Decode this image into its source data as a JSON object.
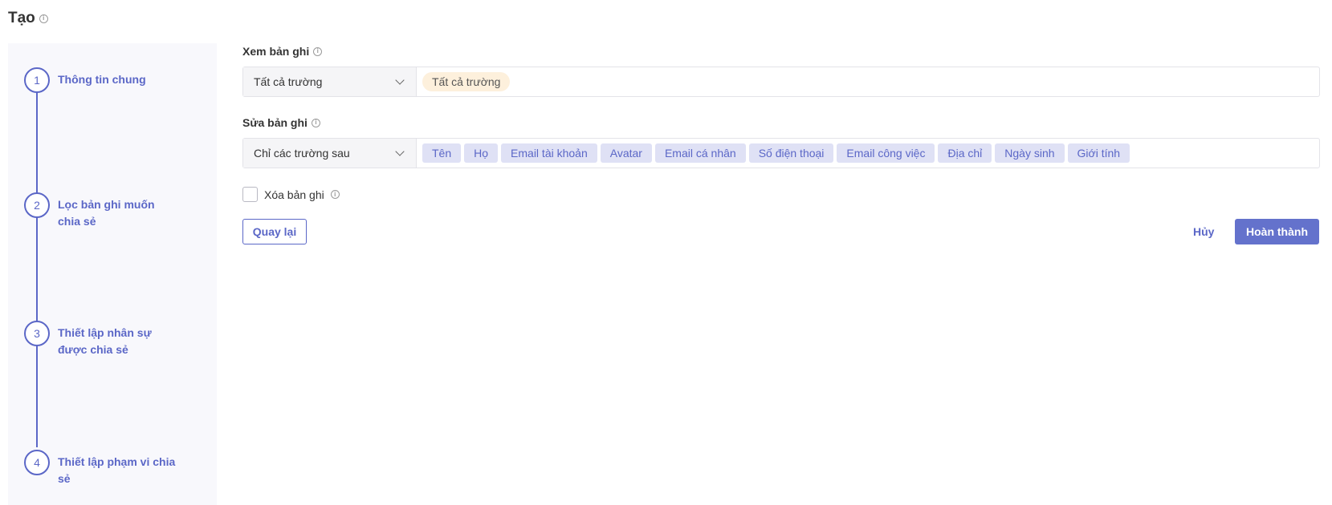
{
  "page": {
    "title": "Tạo"
  },
  "steps": [
    {
      "number": "1",
      "label": "Thông tin chung"
    },
    {
      "number": "2",
      "label": "Lọc bản ghi muốn chia sẻ"
    },
    {
      "number": "3",
      "label": "Thiết lập nhân sự được chia sẻ"
    },
    {
      "number": "4",
      "label": "Thiết lập phạm vi chia sẻ"
    }
  ],
  "view_records": {
    "label": "Xem bản ghi",
    "select_value": "Tất cả trường",
    "tags": [
      "Tất cả trường"
    ]
  },
  "edit_records": {
    "label": "Sửa bản ghi",
    "select_value": "Chỉ các trường sau",
    "tags": [
      "Tên",
      "Họ",
      "Email tài khoản",
      "Avatar",
      "Email cá nhân",
      "Số điện thoại",
      "Email công việc",
      "Địa chỉ",
      "Ngày sinh",
      "Giới tính"
    ]
  },
  "delete_records": {
    "label": "Xóa bản ghi",
    "checked": false
  },
  "actions": {
    "back": "Quay lại",
    "cancel": "Hủy",
    "done": "Hoàn thành"
  },
  "colors": {
    "accent": "#5b67c7",
    "sidebar_bg": "#f8f8fc",
    "tag_bg": "#dfe1f5",
    "tag_all_bg": "#fdf0dc"
  }
}
